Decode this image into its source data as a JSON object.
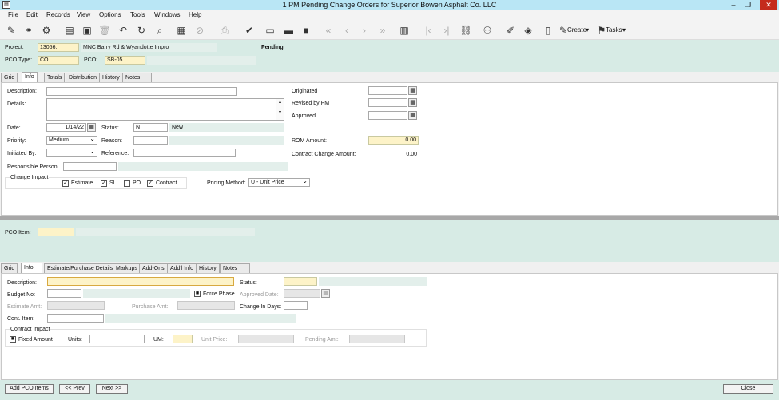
{
  "window": {
    "title": "1 PM Pending Change Orders for Superior Bowen  Asphalt Co. LLC",
    "minimize": "–",
    "restore": "❐",
    "close": "✕"
  },
  "menu": [
    "File",
    "Edit",
    "Records",
    "View",
    "Options",
    "Tools",
    "Windows",
    "Help"
  ],
  "toolbar": {
    "create_label": "Create",
    "tasks_label": "Tasks"
  },
  "header": {
    "project_label": "Project:",
    "project_value": "13056.",
    "project_desc": "MNC Barry Rd & Wyandotte Impro",
    "status_text": "Pending",
    "pco_type_label": "PCO Type:",
    "pco_type_value": "CO",
    "pco_label": "PCO:",
    "pco_value": "SB-05"
  },
  "top_tabs": [
    "Grid",
    "Info",
    "Totals",
    "Distribution",
    "History",
    "Notes"
  ],
  "info": {
    "description_label": "Description:",
    "description_value": "",
    "details_label": "Details:",
    "details_value": "",
    "date_label": "Date:",
    "date_value": "1/14/22",
    "status_label": "Status:",
    "status_value": "N",
    "status_desc": "New",
    "priority_label": "Priority:",
    "priority_value": "Medium",
    "reason_label": "Reason:",
    "reason_value": "",
    "initiated_by_label": "Initiated By:",
    "initiated_by_value": "",
    "reference_label": "Reference:",
    "reference_value": "",
    "responsible_label": "Responsible Person:",
    "responsible_value": "",
    "change_impact_label": "Change Impact",
    "estimate_label": "Estimate",
    "estimate_checked": true,
    "sl_label": "SL",
    "sl_checked": true,
    "po_label": "PO",
    "po_checked": false,
    "contract_label": "Contract",
    "contract_checked": true,
    "pricing_method_label": "Pricing Method:",
    "pricing_method_value": "U - Unit Price",
    "originated_label": "Originated",
    "originated_value": "",
    "revised_label": "Revised by PM",
    "revised_value": "",
    "approved_label": "Approved",
    "approved_value": "",
    "rom_label": "ROM Amount:",
    "rom_value": "0.00",
    "contract_change_label": "Contract Change Amount:",
    "contract_change_value": "0.00"
  },
  "pco_item": {
    "label": "PCO Item:",
    "value": ""
  },
  "item_tabs": [
    "Grid",
    "Info",
    "Estimate/Purchase Details",
    "Markups",
    "Add-Ons",
    "Add'l Info",
    "History",
    "Notes"
  ],
  "item": {
    "description_label": "Description:",
    "description_value": "",
    "status_label": "Status:",
    "status_value": "",
    "budget_no_label": "Budget No:",
    "budget_no_value": "",
    "force_phase_label": "Force Phase",
    "force_phase_checked": true,
    "approved_date_label": "Approved Date:",
    "approved_date_value": "",
    "estimate_amt_label": "Estimate Amt:",
    "estimate_amt_value": "",
    "purchase_amt_label": "Purchase Amt:",
    "purchase_amt_value": "",
    "change_in_days_label": "Change In Days:",
    "change_in_days_value": "",
    "cont_item_label": "Cont. Item:",
    "cont_item_value": "",
    "contract_impact_label": "Contract Impact",
    "fixed_amount_label": "Fixed Amount",
    "fixed_amount_checked": true,
    "units_label": "Units:",
    "units_value": "",
    "um_label": "UM:",
    "um_value": "",
    "unit_price_label": "Unit Price:",
    "unit_price_value": "",
    "pending_amt_label": "Pending Amt:",
    "pending_amt_value": ""
  },
  "footer": {
    "add_pco_items": "Add PCO Items",
    "prev": "<< Prev",
    "next": "Next >>",
    "close": "Close"
  }
}
